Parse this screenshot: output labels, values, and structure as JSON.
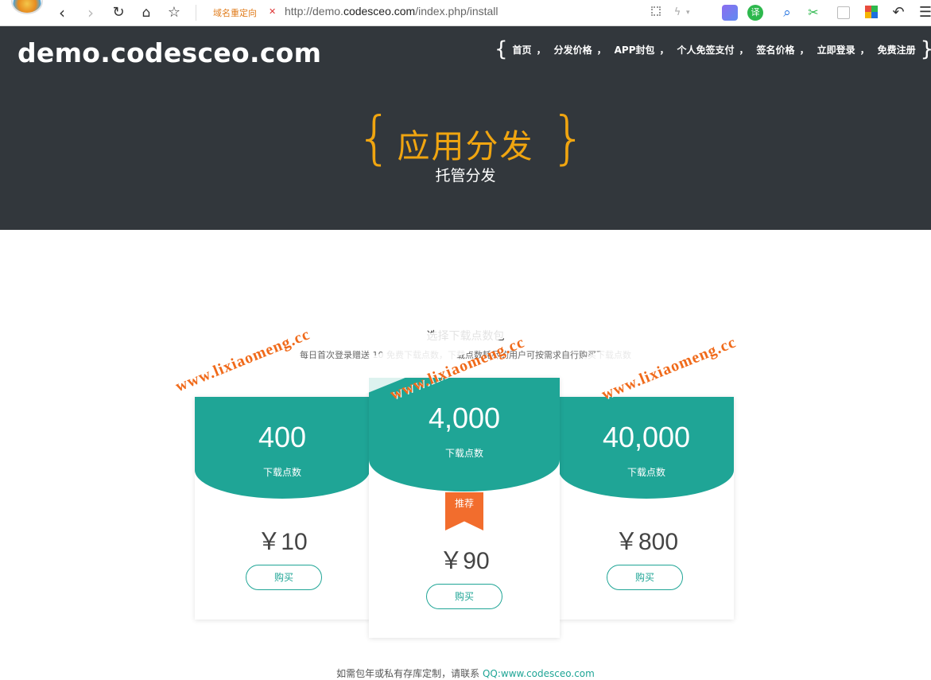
{
  "browser": {
    "redirect_label": "域名重定向",
    "url_prefix": "http://demo.",
    "url_host": "codesceo.com",
    "url_path": "/index.php/install",
    "icons": [
      "back-icon",
      "forward-icon",
      "reload-icon",
      "home-icon",
      "star-icon",
      "qr-icon",
      "bolt-icon",
      "translate-icon",
      "search-icon",
      "scissors-icon",
      "undo-icon",
      "menu-icon"
    ],
    "translate_label": "译"
  },
  "header": {
    "site_title": "demo.codesceo.com",
    "nav": [
      "首页",
      "分发价格",
      "APP封包",
      "个人免签支付",
      "签名价格",
      "立即登录",
      "免费注册"
    ],
    "nav_separator": "，",
    "brace_open": "{",
    "brace_close": "}"
  },
  "hero": {
    "title": "应用分发",
    "subtitle": "托管分发",
    "accent_color": "#f0a510",
    "background_color": "#32373c"
  },
  "section": {
    "heading": "选择下载点数包",
    "description": "每日首次登录赠送 10 免费下载点数，下载点数耗尽的用户可按需求自行购买下载点数"
  },
  "watermark": "www.lixiaomeng.cc",
  "plans": [
    {
      "points": "400",
      "points_label": "下载点数",
      "price": "￥10",
      "buy_label": "购买",
      "featured": false
    },
    {
      "points": "4,000",
      "points_label": "下载点数",
      "price": "￥90",
      "buy_label": "购买",
      "featured": true,
      "badge": "推荐"
    },
    {
      "points": "40,000",
      "points_label": "下载点数",
      "price": "￥800",
      "buy_label": "购买",
      "featured": false
    }
  ],
  "colors": {
    "primary": "#1fa596",
    "badge": "#f26d2d"
  },
  "footer": {
    "text": "如需包年或私有存库定制，请联系 ",
    "link": "QQ:www.codesceo.com"
  }
}
